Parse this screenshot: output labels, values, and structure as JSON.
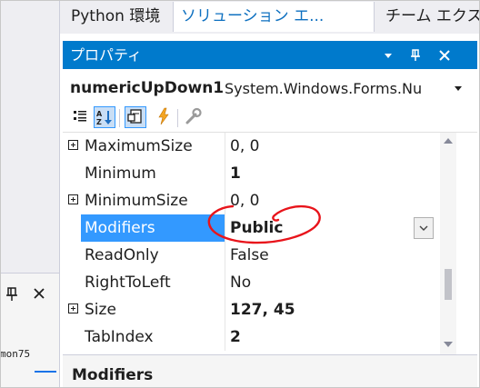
{
  "left_panel": {
    "truncated_text": "mon75"
  },
  "tabs": [
    {
      "label": "Python 環境",
      "active": false
    },
    {
      "label": "ソリューション エ...",
      "active": true
    },
    {
      "label": "チーム エクスプロ...",
      "active": false
    }
  ],
  "properties": {
    "title": "プロパティ",
    "object_name": "numericUpDown1",
    "object_type": "System.Windows.Forms.Nu",
    "rows": [
      {
        "name": "MaximumSize",
        "value": "0, 0",
        "expandable": true,
        "bold": false
      },
      {
        "name": "Minimum",
        "value": "1",
        "expandable": false,
        "bold": true
      },
      {
        "name": "MinimumSize",
        "value": "0, 0",
        "expandable": true,
        "bold": false
      },
      {
        "name": "Modifiers",
        "value": "Public",
        "expandable": false,
        "bold": true,
        "selected": true
      },
      {
        "name": "ReadOnly",
        "value": "False",
        "expandable": false,
        "bold": false
      },
      {
        "name": "RightToLeft",
        "value": "No",
        "expandable": false,
        "bold": false
      },
      {
        "name": "Size",
        "value": "127, 45",
        "expandable": true,
        "bold": true
      },
      {
        "name": "TabIndex",
        "value": "2",
        "expandable": false,
        "bold": true
      }
    ],
    "description_title": "Modifiers"
  },
  "colors": {
    "accent": "#007acc",
    "selection": "#3399ff",
    "annotation": "#e8141b",
    "events_icon": "#f5a623"
  },
  "icons": [
    "pin-icon",
    "close-icon",
    "dropdown-icon",
    "categorized-icon",
    "alphabetical-icon",
    "properties-icon",
    "events-icon",
    "property-pages-icon",
    "scroll-up-icon",
    "scroll-down-icon"
  ]
}
